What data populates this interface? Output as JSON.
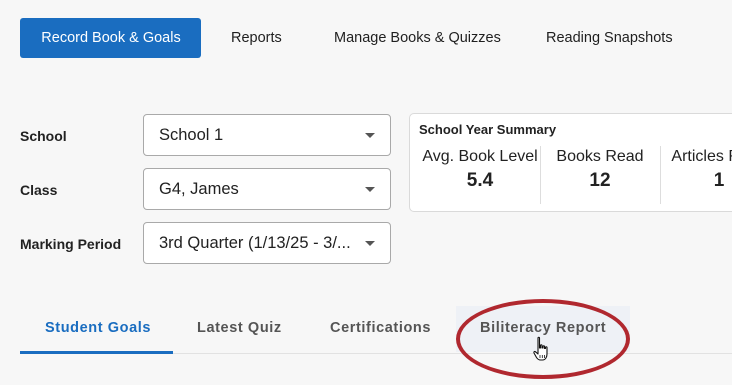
{
  "nav": {
    "tabs": [
      {
        "label": "Record Book & Goals",
        "active": true
      },
      {
        "label": "Reports",
        "active": false
      },
      {
        "label": "Manage Books & Quizzes",
        "active": false
      },
      {
        "label": "Reading Snapshots",
        "active": false
      }
    ]
  },
  "filters": {
    "school": {
      "label": "School",
      "value": "School 1"
    },
    "class": {
      "label": "Class",
      "value": "G4, James"
    },
    "marking_period": {
      "label": "Marking Period",
      "value": "3rd Quarter (1/13/25 - 3/..."
    }
  },
  "summary": {
    "title": "School Year Summary",
    "stats": [
      {
        "label": "Avg. Book Level",
        "value": "5.4"
      },
      {
        "label": "Books Read",
        "value": "12"
      },
      {
        "label": "Articles Read",
        "value": "1"
      }
    ]
  },
  "subtabs": [
    {
      "label": "Student Goals",
      "active": true
    },
    {
      "label": "Latest Quiz",
      "active": false
    },
    {
      "label": "Certifications",
      "active": false
    },
    {
      "label": "Biliteracy Report",
      "active": false,
      "highlighted": true
    }
  ],
  "colors": {
    "primary": "#1a6dc0",
    "highlight": "#b0282f",
    "background": "#f7f7f7"
  },
  "icons": {
    "dropdown": "chevron-down-icon",
    "cursor": "hand-pointer-icon"
  }
}
